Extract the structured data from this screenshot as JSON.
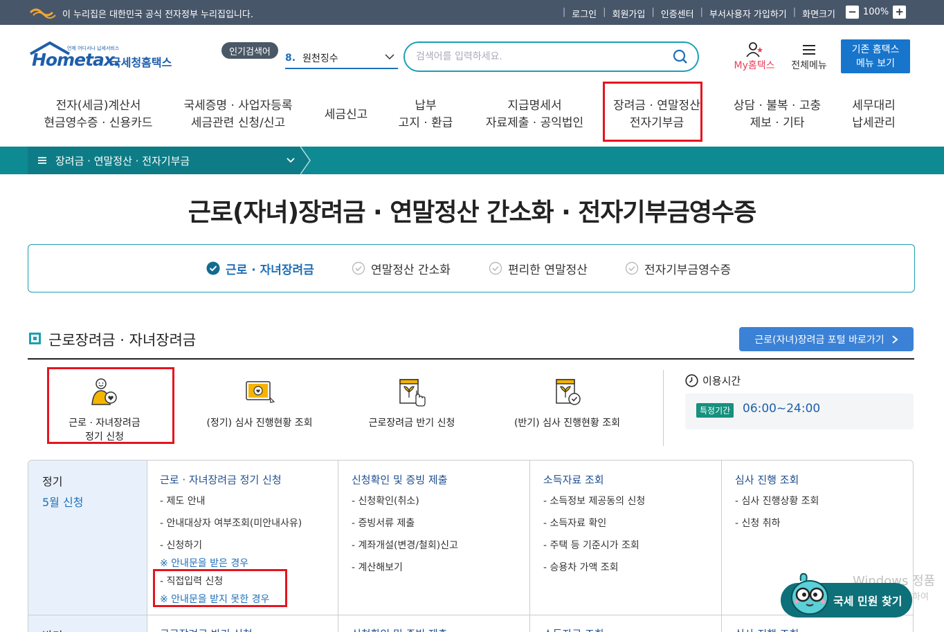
{
  "gov_bar": {
    "message": "이 누리집은 대한민국 공식 전자정부 누리집입니다.",
    "links": [
      "로그인",
      "회원가입",
      "인증센터",
      "부서사용자 가입하기",
      "화면크기"
    ],
    "zoom_minus": "−",
    "zoom_level": "100%",
    "zoom_plus": "+"
  },
  "header": {
    "logo_text": "Hometax.",
    "logo_sub": "국세청홈택스",
    "logo_tagline": "언제 어디서나 납세서비스",
    "popular_badge": "인기검색어",
    "popular_num": "8.",
    "popular_item": "원천징수",
    "search_placeholder": "검색어를 입력하세요.",
    "my_hometax": "My홈택스",
    "all_menu": "전체메뉴",
    "legacy_line1": "기존 홈택스",
    "legacy_line2": "메뉴 보기"
  },
  "gnb": [
    {
      "l1": "전자(세금)계산서",
      "l2": "현금영수증 · 신용카드"
    },
    {
      "l1": "국세증명 · 사업자등록",
      "l2": "세금관련 신청/신고"
    },
    {
      "l1": "세금신고",
      "l2": ""
    },
    {
      "l1": "납부",
      "l2": "고지 · 환급"
    },
    {
      "l1": "지급명세서",
      "l2": "자료제출 · 공익법인"
    },
    {
      "l1": "장려금 · 연말정산",
      "l2": "전자기부금"
    },
    {
      "l1": "상담 · 불복 · 고충",
      "l2": "제보 · 기타"
    },
    {
      "l1": "세무대리",
      "l2": "납세관리"
    }
  ],
  "subnav": {
    "label": "장려금 · 연말정산 · 전자기부금"
  },
  "page_title": "근로(자녀)장려금 · 연말정산 간소화 · 전자기부금영수증",
  "tabs": [
    {
      "label": "근로 · 자녀장려금"
    },
    {
      "label": "연말정산 간소화"
    },
    {
      "label": "편리한 연말정산"
    },
    {
      "label": "전자기부금영수증"
    }
  ],
  "section": {
    "title": "근로장려금 · 자녀장려금",
    "portal_button": "근로(자녀)장려금 포털 바로가기"
  },
  "shortcuts": [
    {
      "l1": "근로 · 자녀장려금",
      "l2": "정기 신청"
    },
    {
      "l1": "(정기) 심사 진행현황 조회",
      "l2": ""
    },
    {
      "l1": "근로장려금 반기 신청",
      "l2": ""
    },
    {
      "l1": "(반기) 심사 진행현황 조회",
      "l2": ""
    }
  ],
  "hours": {
    "label": "이용시간",
    "badge": "특정기간",
    "time": "06:00~24:00"
  },
  "grid": {
    "left_title": "정기",
    "left_sub": "5월 신청",
    "left2_title": "반기",
    "columns": [
      {
        "title": "근로 · 자녀장려금 정기 신청",
        "items": [
          "- 제도 안내",
          "- 안내대상자 여부조회(미안내사유)",
          "- 신청하기"
        ],
        "note1": "※ 안내문을 받은 경우",
        "item4": "- 직접입력 신청",
        "note2": "※ 안내문을 받지 못한 경우"
      },
      {
        "title": "신청확인 및 증빙 제출",
        "items": [
          "- 신청확인(취소)",
          "- 증빙서류 제출",
          "- 계좌개설(변경/철회)신고",
          "- 계산해보기"
        ]
      },
      {
        "title": "소득자료 조회",
        "items": [
          "- 소득정보 제공동의 신청",
          "- 소득자료 확인",
          "- 주택 등 기준시가 조회",
          "- 승용차 가액 조회"
        ]
      },
      {
        "title": "심사 진행 조회",
        "items": [
          "- 심사 진행상황 조회",
          "- 신청 취하"
        ]
      }
    ],
    "row2_titles": [
      "근로장려금 반기 신청",
      "신청확인 및 증빙 제출",
      "소득자료 조회",
      "심사 진행 조회"
    ]
  },
  "watermark": {
    "line1": "Windows 정품",
    "line2": "[설정]으로 이동하여"
  },
  "civil_button": "국세 민원 찾기",
  "colors": {
    "teal": "#0e8a92",
    "primary": "#1e6fb8",
    "highlight": "#e5141e",
    "gov_bar": "#48566a"
  }
}
